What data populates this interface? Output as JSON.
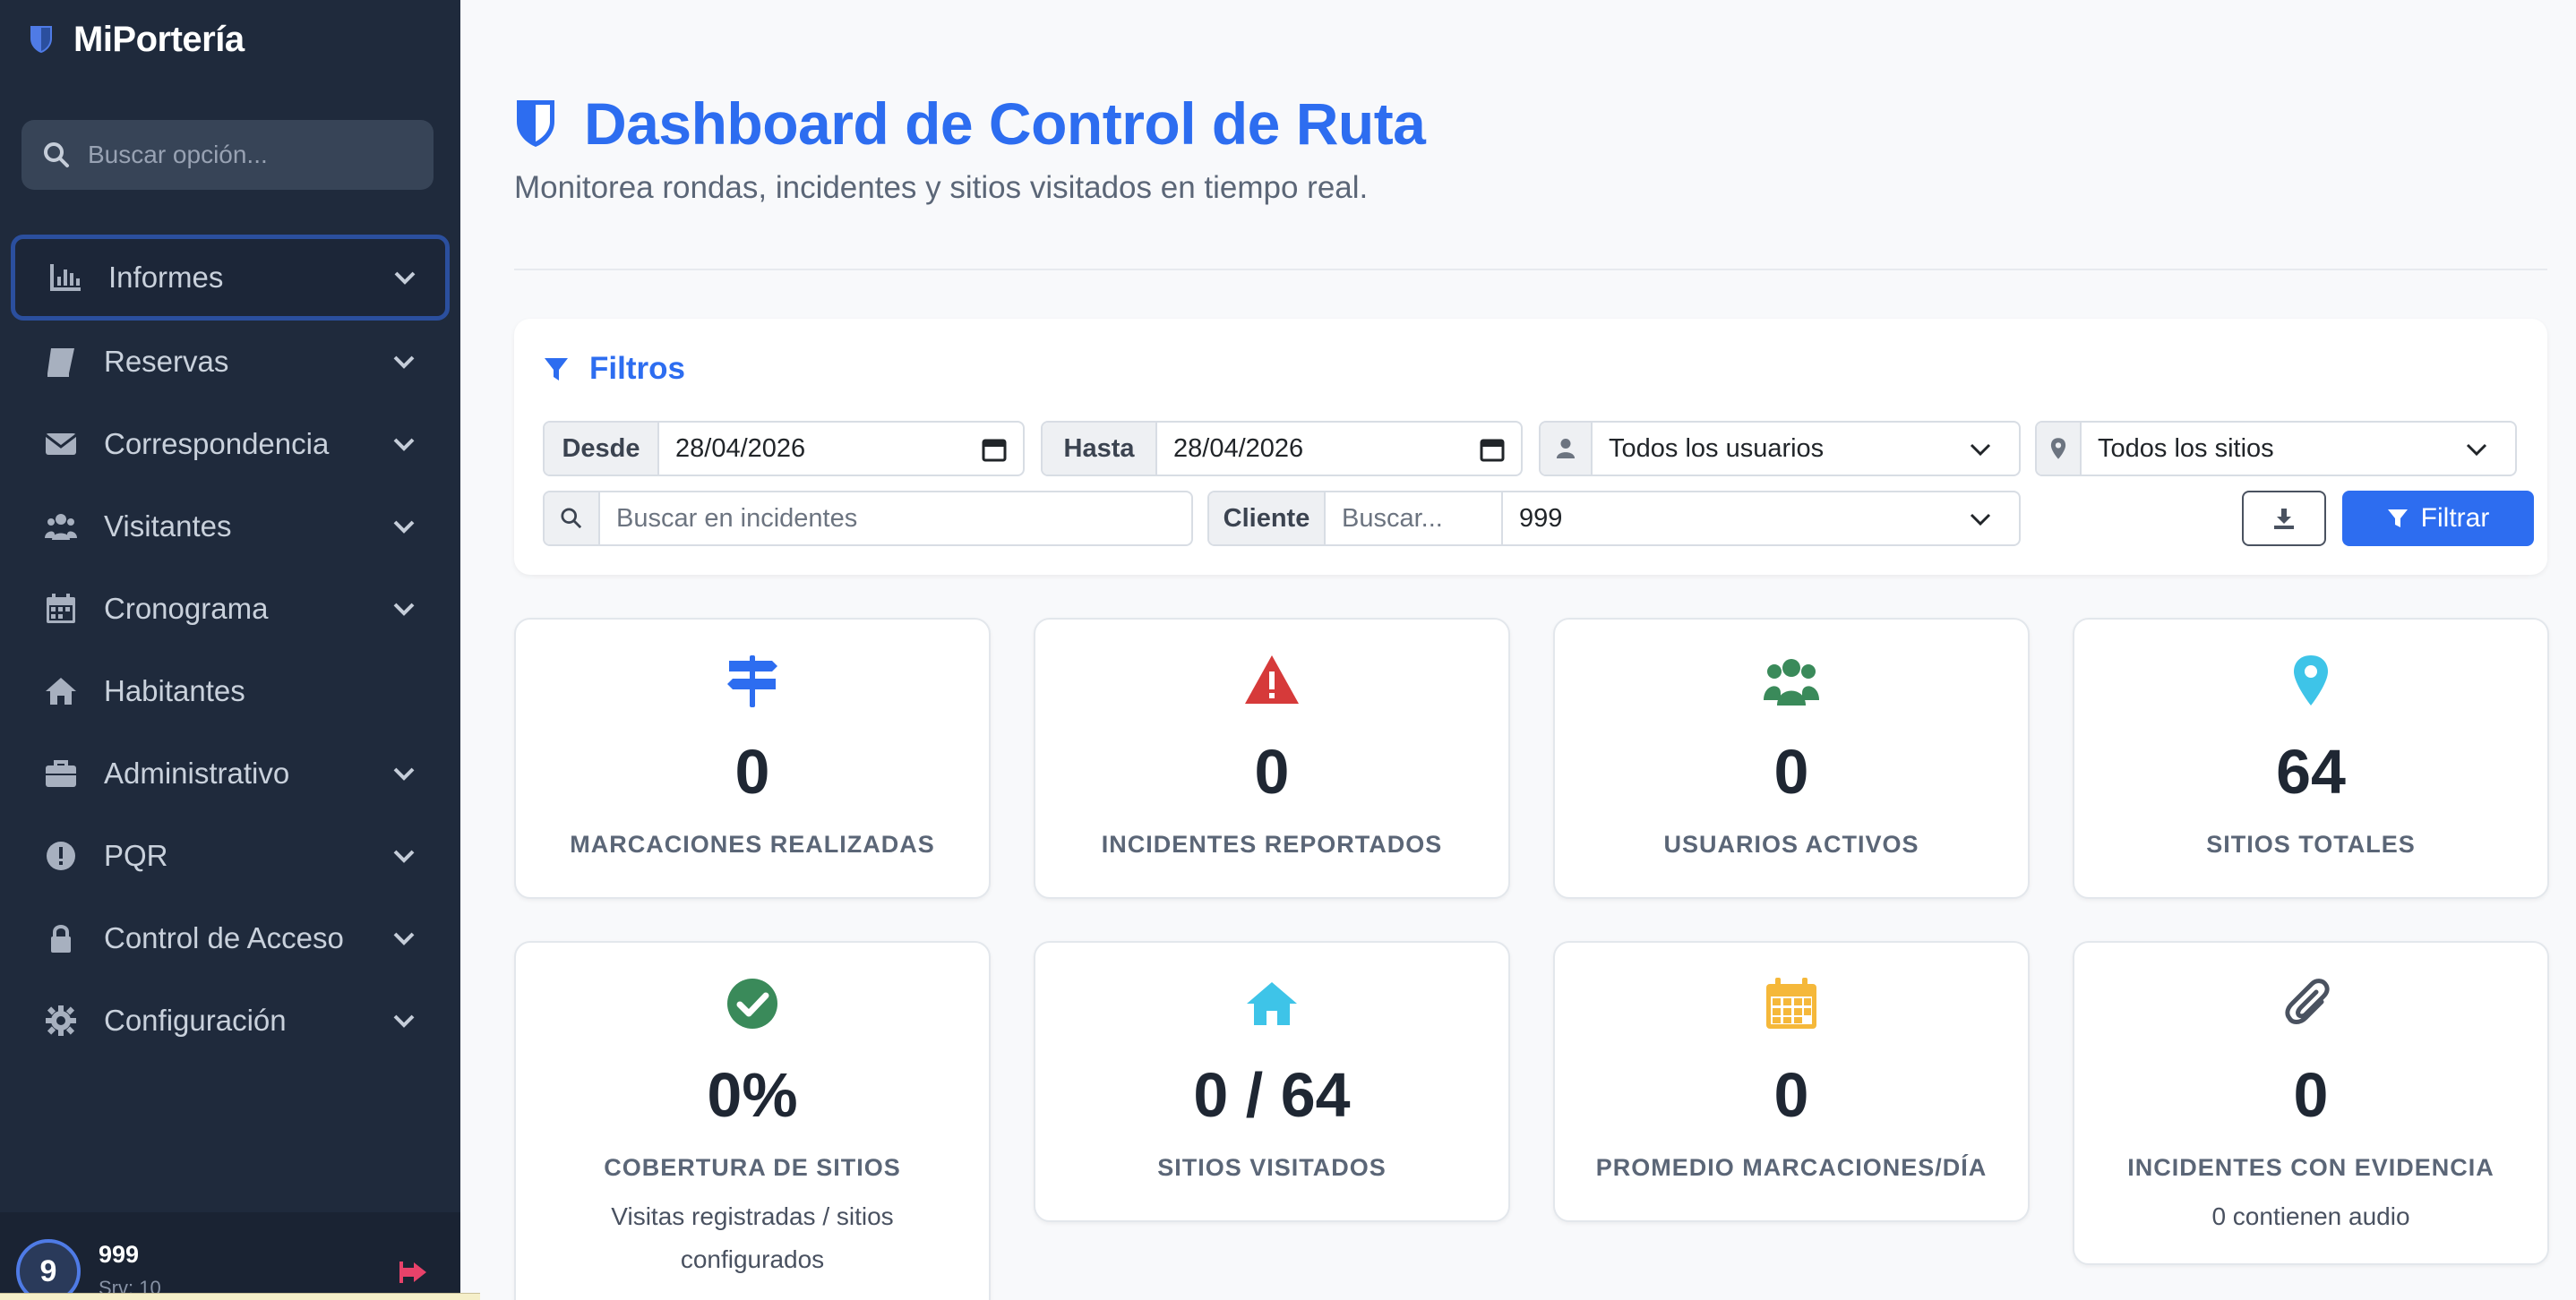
{
  "app": {
    "brand": "MiPortería"
  },
  "sidebar": {
    "search_placeholder": "Buscar opción...",
    "items": [
      {
        "label": "Informes",
        "icon": "bar-chart-icon",
        "has_submenu": true,
        "active": true
      },
      {
        "label": "Reservas",
        "icon": "book-icon",
        "has_submenu": true
      },
      {
        "label": "Correspondencia",
        "icon": "envelope-icon",
        "has_submenu": true
      },
      {
        "label": "Visitantes",
        "icon": "users-icon",
        "has_submenu": true
      },
      {
        "label": "Cronograma",
        "icon": "calendar-icon",
        "has_submenu": true
      },
      {
        "label": "Habitantes",
        "icon": "home-icon",
        "has_submenu": false
      },
      {
        "label": "Administrativo",
        "icon": "briefcase-icon",
        "has_submenu": true
      },
      {
        "label": "PQR",
        "icon": "exclamation-circle-icon",
        "has_submenu": true
      },
      {
        "label": "Control de Acceso",
        "icon": "lock-icon",
        "has_submenu": true
      },
      {
        "label": "Configuración",
        "icon": "gear-icon",
        "has_submenu": true
      }
    ],
    "footer": {
      "avatar_initial": "9",
      "user_name": "999",
      "user_sub": "Srv: 10"
    }
  },
  "header": {
    "title": "Dashboard de Control de Ruta",
    "subtitle": "Monitorea rondas, incidentes y sitios visitados en tiempo real."
  },
  "filters": {
    "title": "Filtros",
    "desde_label": "Desde",
    "desde_value": "28/04/2026",
    "hasta_label": "Hasta",
    "hasta_value": "28/04/2026",
    "users_select": "Todos los usuarios",
    "sites_select": "Todos los sitios",
    "search_placeholder": "Buscar en incidentes",
    "cliente_label": "Cliente",
    "cliente_search_placeholder": "Buscar...",
    "cliente_select": "999",
    "filter_button": "Filtrar"
  },
  "stats": [
    {
      "value": "0",
      "label": "MARCACIONES REALIZADAS",
      "icon": "signpost-icon",
      "color": "#2d6df0"
    },
    {
      "value": "0",
      "label": "INCIDENTES REPORTADOS",
      "icon": "warning-icon",
      "color": "#d63a3a"
    },
    {
      "value": "0",
      "label": "USUARIOS ACTIVOS",
      "icon": "users-icon",
      "color": "#3a8a5a"
    },
    {
      "value": "64",
      "label": "SITIOS TOTALES",
      "icon": "map-pin-icon",
      "color": "#3ec4e8"
    },
    {
      "value": "0%",
      "label": "COBERTURA DE SITIOS",
      "note": "Visitas registradas / sitios configurados",
      "icon": "check-circle-icon",
      "color": "#3a8a5a"
    },
    {
      "value": "0 / 64",
      "label": "SITIOS VISITADOS",
      "icon": "home-icon",
      "color": "#3ec4e8"
    },
    {
      "value": "0",
      "label": "PROMEDIO MARCACIONES/DÍA",
      "icon": "calendar-icon",
      "color": "#f5b83a"
    },
    {
      "value": "0",
      "label": "INCIDENTES CON EVIDENCIA",
      "note": "0 contienen audio",
      "icon": "paperclip-icon",
      "color": "#4a5260"
    }
  ],
  "colors": {
    "accent": "#2d6df0",
    "sidebar_bg": "#1f2a3c",
    "logout": "#e8426a"
  }
}
